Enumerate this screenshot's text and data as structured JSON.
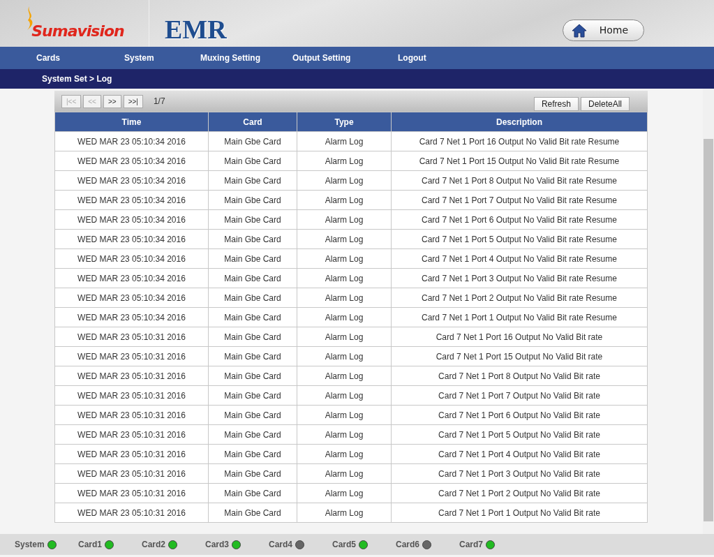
{
  "header": {
    "logo_text": "Sumavision",
    "product": "EMR",
    "home_button": "Home"
  },
  "nav": [
    "Cards",
    "System",
    "Muxing Setting",
    "Output Setting",
    "Logout"
  ],
  "breadcrumb": "System Set > Log",
  "pager": {
    "buttons": [
      {
        "label": "|<<",
        "disabled": true
      },
      {
        "label": "<<",
        "disabled": true
      },
      {
        "label": ">>",
        "disabled": false
      },
      {
        "label": ">>|",
        "disabled": false
      }
    ],
    "page": "1/7"
  },
  "actions": [
    "Refresh",
    "DeleteAll"
  ],
  "table": {
    "columns": [
      "Time",
      "Card",
      "Type",
      "Description"
    ],
    "rows": [
      [
        "WED MAR 23 05:10:34 2016",
        "Main Gbe Card",
        "Alarm Log",
        "Card 7 Net 1 Port 16 Output No Valid Bit rate Resume"
      ],
      [
        "WED MAR 23 05:10:34 2016",
        "Main Gbe Card",
        "Alarm Log",
        "Card 7 Net 1 Port 15 Output No Valid Bit rate Resume"
      ],
      [
        "WED MAR 23 05:10:34 2016",
        "Main Gbe Card",
        "Alarm Log",
        "Card 7 Net 1 Port 8 Output No Valid Bit rate Resume"
      ],
      [
        "WED MAR 23 05:10:34 2016",
        "Main Gbe Card",
        "Alarm Log",
        "Card 7 Net 1 Port 7 Output No Valid Bit rate Resume"
      ],
      [
        "WED MAR 23 05:10:34 2016",
        "Main Gbe Card",
        "Alarm Log",
        "Card 7 Net 1 Port 6 Output No Valid Bit rate Resume"
      ],
      [
        "WED MAR 23 05:10:34 2016",
        "Main Gbe Card",
        "Alarm Log",
        "Card 7 Net 1 Port 5 Output No Valid Bit rate Resume"
      ],
      [
        "WED MAR 23 05:10:34 2016",
        "Main Gbe Card",
        "Alarm Log",
        "Card 7 Net 1 Port 4 Output No Valid Bit rate Resume"
      ],
      [
        "WED MAR 23 05:10:34 2016",
        "Main Gbe Card",
        "Alarm Log",
        "Card 7 Net 1 Port 3 Output No Valid Bit rate Resume"
      ],
      [
        "WED MAR 23 05:10:34 2016",
        "Main Gbe Card",
        "Alarm Log",
        "Card 7 Net 1 Port 2 Output No Valid Bit rate Resume"
      ],
      [
        "WED MAR 23 05:10:34 2016",
        "Main Gbe Card",
        "Alarm Log",
        "Card 7 Net 1 Port 1 Output No Valid Bit rate Resume"
      ],
      [
        "WED MAR 23 05:10:31 2016",
        "Main Gbe Card",
        "Alarm Log",
        "Card 7 Net 1 Port 16 Output No Valid Bit rate"
      ],
      [
        "WED MAR 23 05:10:31 2016",
        "Main Gbe Card",
        "Alarm Log",
        "Card 7 Net 1 Port 15 Output No Valid Bit rate"
      ],
      [
        "WED MAR 23 05:10:31 2016",
        "Main Gbe Card",
        "Alarm Log",
        "Card 7 Net 1 Port 8 Output No Valid Bit rate"
      ],
      [
        "WED MAR 23 05:10:31 2016",
        "Main Gbe Card",
        "Alarm Log",
        "Card 7 Net 1 Port 7 Output No Valid Bit rate"
      ],
      [
        "WED MAR 23 05:10:31 2016",
        "Main Gbe Card",
        "Alarm Log",
        "Card 7 Net 1 Port 6 Output No Valid Bit rate"
      ],
      [
        "WED MAR 23 05:10:31 2016",
        "Main Gbe Card",
        "Alarm Log",
        "Card 7 Net 1 Port 5 Output No Valid Bit rate"
      ],
      [
        "WED MAR 23 05:10:31 2016",
        "Main Gbe Card",
        "Alarm Log",
        "Card 7 Net 1 Port 4 Output No Valid Bit rate"
      ],
      [
        "WED MAR 23 05:10:31 2016",
        "Main Gbe Card",
        "Alarm Log",
        "Card 7 Net 1 Port 3 Output No Valid Bit rate"
      ],
      [
        "WED MAR 23 05:10:31 2016",
        "Main Gbe Card",
        "Alarm Log",
        "Card 7 Net 1 Port 2 Output No Valid Bit rate"
      ],
      [
        "WED MAR 23 05:10:31 2016",
        "Main Gbe Card",
        "Alarm Log",
        "Card 7 Net 1 Port 1 Output No Valid Bit rate"
      ]
    ]
  },
  "status": [
    {
      "label": "System",
      "color": "#22bb22"
    },
    {
      "label": "Card1",
      "color": "#22bb22"
    },
    {
      "label": "Card2",
      "color": "#22bb22"
    },
    {
      "label": "Card3",
      "color": "#22bb22"
    },
    {
      "label": "Card4",
      "color": "#666666"
    },
    {
      "label": "Card5",
      "color": "#22bb22"
    },
    {
      "label": "Card6",
      "color": "#666666"
    },
    {
      "label": "Card7",
      "color": "#22bb22"
    }
  ]
}
